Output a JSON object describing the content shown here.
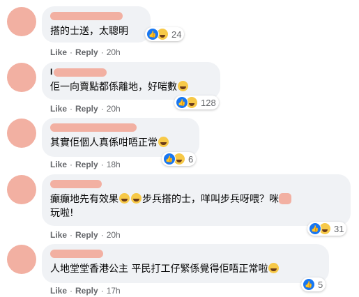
{
  "comments": [
    {
      "name_prefix": "",
      "text": "搭的士送，太聰明",
      "reaction_count": "24",
      "like_label": "Like",
      "reply_label": "Reply",
      "dot": "·",
      "time": "20h"
    },
    {
      "name_prefix": "I",
      "text": "佢一向賣點都係離地，好啱數",
      "reaction_count": "128",
      "like_label": "Like",
      "reply_label": "Reply",
      "dot": "·",
      "time": "20h"
    },
    {
      "name_prefix": "",
      "text": "其實佢個人真係咁唔正常",
      "reaction_count": "6",
      "like_label": "Like",
      "reply_label": "Reply",
      "dot": "·",
      "time": "18h"
    },
    {
      "name_prefix": "",
      "text_line1_a": "癲癲地先有效果",
      "text_line1_b": "步兵搭的士，咩叫步兵呀喂？咪",
      "text_line2": "玩啦!",
      "reaction_count": "31",
      "like_label": "Like",
      "reply_label": "Reply",
      "dot": "·",
      "time": "20h"
    },
    {
      "name_prefix": "",
      "text": "人地堂堂香港公主 平民打工仔緊係覺得佢唔正常啦",
      "reaction_count": "5",
      "like_label": "Like",
      "reply_label": "Reply",
      "dot": "·",
      "time": "17h"
    }
  ],
  "colors": {
    "bubble": "#f0f2f5",
    "redaction": "#f2b0a2",
    "like_blue": "#1877f2",
    "haha_yellow": "#f7c948",
    "meta_gray": "#65676b"
  },
  "icons": [
    "like-reaction-icon",
    "haha-reaction-icon",
    "laughing-emoji",
    "rofl-emoji"
  ]
}
